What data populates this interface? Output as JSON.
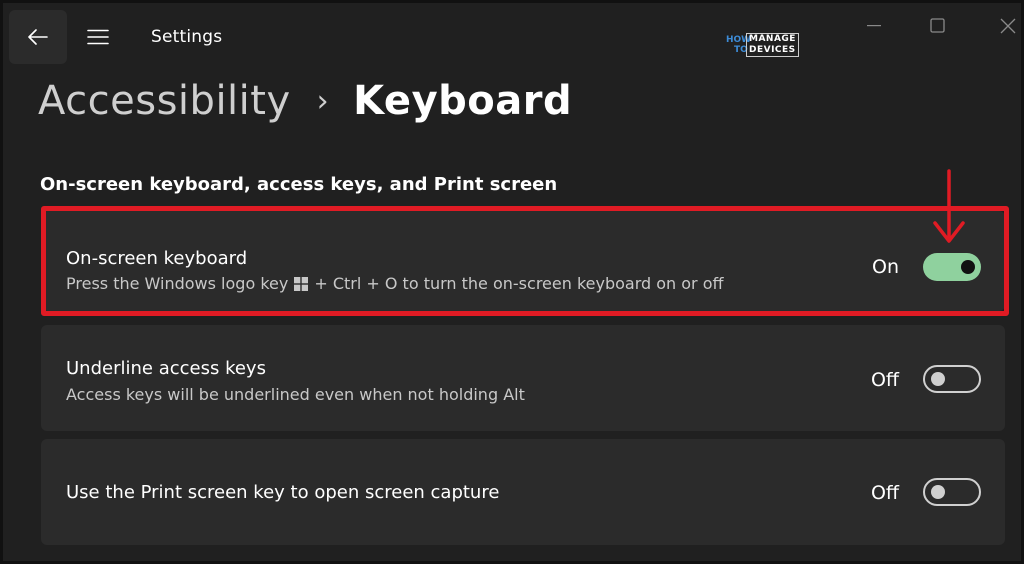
{
  "app": {
    "title": "Settings"
  },
  "logo": {
    "line1": "HOW",
    "line2": "TO",
    "brand_top": "MANAGE",
    "brand_bottom": "DEVICES"
  },
  "breadcrumb": {
    "parent": "Accessibility",
    "separator": "›",
    "current": "Keyboard"
  },
  "section": {
    "title": "On-screen keyboard, access keys, and Print screen"
  },
  "settings": [
    {
      "title": "On-screen keyboard",
      "desc_before": "Press the Windows logo key",
      "desc_after": "+ Ctrl + O to turn the on-screen keyboard on or off",
      "state_label": "On",
      "state": true
    },
    {
      "title": "Underline access keys",
      "desc": "Access keys will be underlined even when not holding Alt",
      "state_label": "Off",
      "state": false
    },
    {
      "title": "Use the Print screen key to open screen capture",
      "state_label": "Off",
      "state": false
    }
  ],
  "icons": {
    "back": "back-arrow-icon",
    "menu": "hamburger-menu-icon",
    "minimize": "minimize-icon",
    "maximize": "maximize-icon",
    "close": "close-icon",
    "windows": "windows-logo-icon"
  },
  "colors": {
    "background": "#202020",
    "card": "#2b2b2b",
    "toggle_on": "#8fd19e",
    "highlight": "#e01b24"
  }
}
